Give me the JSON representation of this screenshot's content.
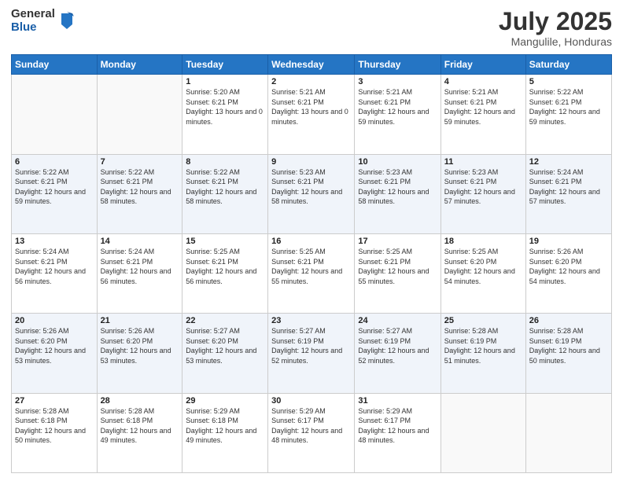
{
  "logo": {
    "general": "General",
    "blue": "Blue"
  },
  "header": {
    "title": "July 2025",
    "subtitle": "Mangulile, Honduras"
  },
  "weekdays": [
    "Sunday",
    "Monday",
    "Tuesday",
    "Wednesday",
    "Thursday",
    "Friday",
    "Saturday"
  ],
  "weeks": [
    [
      {
        "day": "",
        "sunrise": "",
        "sunset": "",
        "daylight": ""
      },
      {
        "day": "",
        "sunrise": "",
        "sunset": "",
        "daylight": ""
      },
      {
        "day": "1",
        "sunrise": "Sunrise: 5:20 AM",
        "sunset": "Sunset: 6:21 PM",
        "daylight": "Daylight: 13 hours and 0 minutes."
      },
      {
        "day": "2",
        "sunrise": "Sunrise: 5:21 AM",
        "sunset": "Sunset: 6:21 PM",
        "daylight": "Daylight: 13 hours and 0 minutes."
      },
      {
        "day": "3",
        "sunrise": "Sunrise: 5:21 AM",
        "sunset": "Sunset: 6:21 PM",
        "daylight": "Daylight: 12 hours and 59 minutes."
      },
      {
        "day": "4",
        "sunrise": "Sunrise: 5:21 AM",
        "sunset": "Sunset: 6:21 PM",
        "daylight": "Daylight: 12 hours and 59 minutes."
      },
      {
        "day": "5",
        "sunrise": "Sunrise: 5:22 AM",
        "sunset": "Sunset: 6:21 PM",
        "daylight": "Daylight: 12 hours and 59 minutes."
      }
    ],
    [
      {
        "day": "6",
        "sunrise": "Sunrise: 5:22 AM",
        "sunset": "Sunset: 6:21 PM",
        "daylight": "Daylight: 12 hours and 59 minutes."
      },
      {
        "day": "7",
        "sunrise": "Sunrise: 5:22 AM",
        "sunset": "Sunset: 6:21 PM",
        "daylight": "Daylight: 12 hours and 58 minutes."
      },
      {
        "day": "8",
        "sunrise": "Sunrise: 5:22 AM",
        "sunset": "Sunset: 6:21 PM",
        "daylight": "Daylight: 12 hours and 58 minutes."
      },
      {
        "day": "9",
        "sunrise": "Sunrise: 5:23 AM",
        "sunset": "Sunset: 6:21 PM",
        "daylight": "Daylight: 12 hours and 58 minutes."
      },
      {
        "day": "10",
        "sunrise": "Sunrise: 5:23 AM",
        "sunset": "Sunset: 6:21 PM",
        "daylight": "Daylight: 12 hours and 58 minutes."
      },
      {
        "day": "11",
        "sunrise": "Sunrise: 5:23 AM",
        "sunset": "Sunset: 6:21 PM",
        "daylight": "Daylight: 12 hours and 57 minutes."
      },
      {
        "day": "12",
        "sunrise": "Sunrise: 5:24 AM",
        "sunset": "Sunset: 6:21 PM",
        "daylight": "Daylight: 12 hours and 57 minutes."
      }
    ],
    [
      {
        "day": "13",
        "sunrise": "Sunrise: 5:24 AM",
        "sunset": "Sunset: 6:21 PM",
        "daylight": "Daylight: 12 hours and 56 minutes."
      },
      {
        "day": "14",
        "sunrise": "Sunrise: 5:24 AM",
        "sunset": "Sunset: 6:21 PM",
        "daylight": "Daylight: 12 hours and 56 minutes."
      },
      {
        "day": "15",
        "sunrise": "Sunrise: 5:25 AM",
        "sunset": "Sunset: 6:21 PM",
        "daylight": "Daylight: 12 hours and 56 minutes."
      },
      {
        "day": "16",
        "sunrise": "Sunrise: 5:25 AM",
        "sunset": "Sunset: 6:21 PM",
        "daylight": "Daylight: 12 hours and 55 minutes."
      },
      {
        "day": "17",
        "sunrise": "Sunrise: 5:25 AM",
        "sunset": "Sunset: 6:21 PM",
        "daylight": "Daylight: 12 hours and 55 minutes."
      },
      {
        "day": "18",
        "sunrise": "Sunrise: 5:25 AM",
        "sunset": "Sunset: 6:20 PM",
        "daylight": "Daylight: 12 hours and 54 minutes."
      },
      {
        "day": "19",
        "sunrise": "Sunrise: 5:26 AM",
        "sunset": "Sunset: 6:20 PM",
        "daylight": "Daylight: 12 hours and 54 minutes."
      }
    ],
    [
      {
        "day": "20",
        "sunrise": "Sunrise: 5:26 AM",
        "sunset": "Sunset: 6:20 PM",
        "daylight": "Daylight: 12 hours and 53 minutes."
      },
      {
        "day": "21",
        "sunrise": "Sunrise: 5:26 AM",
        "sunset": "Sunset: 6:20 PM",
        "daylight": "Daylight: 12 hours and 53 minutes."
      },
      {
        "day": "22",
        "sunrise": "Sunrise: 5:27 AM",
        "sunset": "Sunset: 6:20 PM",
        "daylight": "Daylight: 12 hours and 53 minutes."
      },
      {
        "day": "23",
        "sunrise": "Sunrise: 5:27 AM",
        "sunset": "Sunset: 6:19 PM",
        "daylight": "Daylight: 12 hours and 52 minutes."
      },
      {
        "day": "24",
        "sunrise": "Sunrise: 5:27 AM",
        "sunset": "Sunset: 6:19 PM",
        "daylight": "Daylight: 12 hours and 52 minutes."
      },
      {
        "day": "25",
        "sunrise": "Sunrise: 5:28 AM",
        "sunset": "Sunset: 6:19 PM",
        "daylight": "Daylight: 12 hours and 51 minutes."
      },
      {
        "day": "26",
        "sunrise": "Sunrise: 5:28 AM",
        "sunset": "Sunset: 6:19 PM",
        "daylight": "Daylight: 12 hours and 50 minutes."
      }
    ],
    [
      {
        "day": "27",
        "sunrise": "Sunrise: 5:28 AM",
        "sunset": "Sunset: 6:18 PM",
        "daylight": "Daylight: 12 hours and 50 minutes."
      },
      {
        "day": "28",
        "sunrise": "Sunrise: 5:28 AM",
        "sunset": "Sunset: 6:18 PM",
        "daylight": "Daylight: 12 hours and 49 minutes."
      },
      {
        "day": "29",
        "sunrise": "Sunrise: 5:29 AM",
        "sunset": "Sunset: 6:18 PM",
        "daylight": "Daylight: 12 hours and 49 minutes."
      },
      {
        "day": "30",
        "sunrise": "Sunrise: 5:29 AM",
        "sunset": "Sunset: 6:17 PM",
        "daylight": "Daylight: 12 hours and 48 minutes."
      },
      {
        "day": "31",
        "sunrise": "Sunrise: 5:29 AM",
        "sunset": "Sunset: 6:17 PM",
        "daylight": "Daylight: 12 hours and 48 minutes."
      },
      {
        "day": "",
        "sunrise": "",
        "sunset": "",
        "daylight": ""
      },
      {
        "day": "",
        "sunrise": "",
        "sunset": "",
        "daylight": ""
      }
    ]
  ]
}
